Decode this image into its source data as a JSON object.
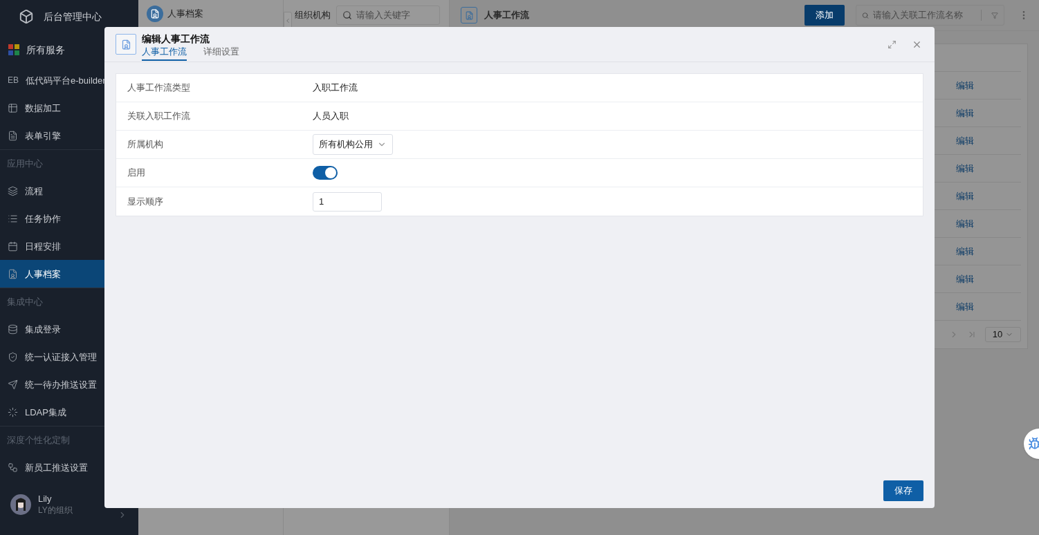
{
  "sidebar": {
    "title": "后台管理中心",
    "all_services": "所有服务",
    "items": [
      {
        "kind": "item",
        "badge": "EB",
        "label": "低代码平台e-builder",
        "selected": false
      },
      {
        "kind": "item",
        "label": "数据加工",
        "selected": false
      },
      {
        "kind": "item",
        "label": "表单引擎",
        "selected": false
      },
      {
        "kind": "section",
        "label": "应用中心"
      },
      {
        "kind": "item",
        "label": "流程",
        "selected": false
      },
      {
        "kind": "item",
        "label": "任务协作",
        "selected": false
      },
      {
        "kind": "item",
        "label": "日程安排",
        "selected": false
      },
      {
        "kind": "item",
        "label": "人事档案",
        "selected": true
      },
      {
        "kind": "section",
        "label": "集成中心"
      },
      {
        "kind": "item",
        "label": "集成登录",
        "selected": false
      },
      {
        "kind": "item",
        "label": "统一认证接入管理",
        "selected": false
      },
      {
        "kind": "item",
        "label": "统一待办推送设置",
        "selected": false
      },
      {
        "kind": "item",
        "label": "LDAP集成",
        "selected": false
      },
      {
        "kind": "section",
        "label": "深度个性化定制"
      },
      {
        "kind": "item",
        "label": "新员工推送设置",
        "selected": false
      }
    ],
    "user": {
      "name": "Lily",
      "org": "LY的组织"
    }
  },
  "module_panel": {
    "title": "人事档案"
  },
  "org_panel": {
    "title": "组织机构",
    "search": {
      "placeholder": "请输入关键字"
    }
  },
  "main_panel": {
    "title": "人事工作流",
    "add_button": "添加",
    "search": {
      "placeholder": "请输入关联工作流名称"
    },
    "table": {
      "rows": [
        {
          "action": "编辑"
        },
        {
          "action": "编辑"
        },
        {
          "action": "编辑"
        },
        {
          "action": "编辑"
        },
        {
          "action": "编辑"
        },
        {
          "action": "编辑"
        },
        {
          "action": "编辑"
        },
        {
          "action": "编辑"
        },
        {
          "action": "编辑"
        }
      ]
    },
    "page_size": "10"
  },
  "dialog": {
    "title": "编辑人事工作流",
    "tabs": [
      {
        "label": "人事工作流",
        "selected": true
      },
      {
        "label": "详细设置",
        "selected": false
      }
    ],
    "fields": [
      {
        "kind": "text",
        "label": "人事工作流类型",
        "value": "入职工作流"
      },
      {
        "kind": "text",
        "label": "关联入职工作流",
        "value": "人员入职"
      },
      {
        "kind": "select",
        "label": "所属机构",
        "value": "所有机构公用"
      },
      {
        "kind": "switch",
        "label": "启用",
        "on": true
      },
      {
        "kind": "input",
        "label": "显示顺序",
        "value": "1"
      }
    ],
    "save_button": "保存"
  }
}
